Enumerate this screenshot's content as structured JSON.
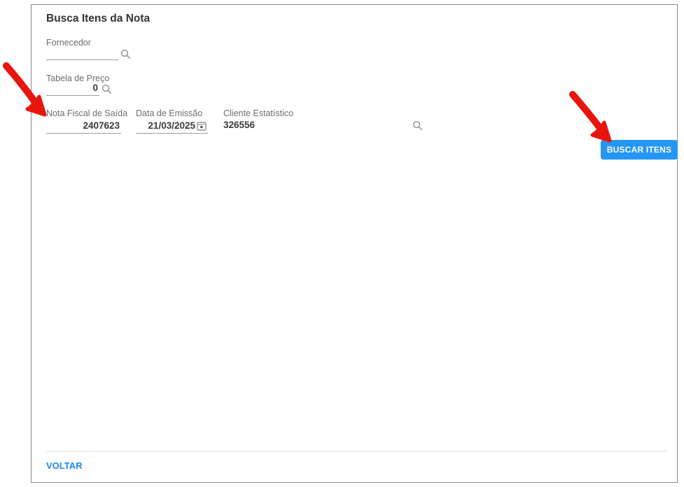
{
  "page": {
    "title": "Busca Itens da Nota"
  },
  "fields": {
    "fornecedor": {
      "label": "Fornecedor",
      "value": ""
    },
    "tabela_de_preco": {
      "label": "Tabela de Preço",
      "value": "0"
    },
    "nota_fiscal_de_saida": {
      "label": "Nota Fiscal de Saída",
      "value": "2407623"
    },
    "data_de_emissao": {
      "label": "Data de Emissão",
      "value": "21/03/2025"
    },
    "cliente_estatistico": {
      "label": "Cliente Estatístico",
      "value": "326556"
    }
  },
  "actions": {
    "buscar_itens": "BUSCAR ITENS",
    "voltar": "VOLTAR"
  },
  "colors": {
    "primary": "#2496F5",
    "link": "#1E88E5",
    "annotation": "#E8150D",
    "border": "#8A8A8A",
    "label": "#6D6D6D",
    "value": "#3A3A3A",
    "underline": "#9E9E9E",
    "divider": "#ECECEC",
    "icon": "#949494"
  }
}
